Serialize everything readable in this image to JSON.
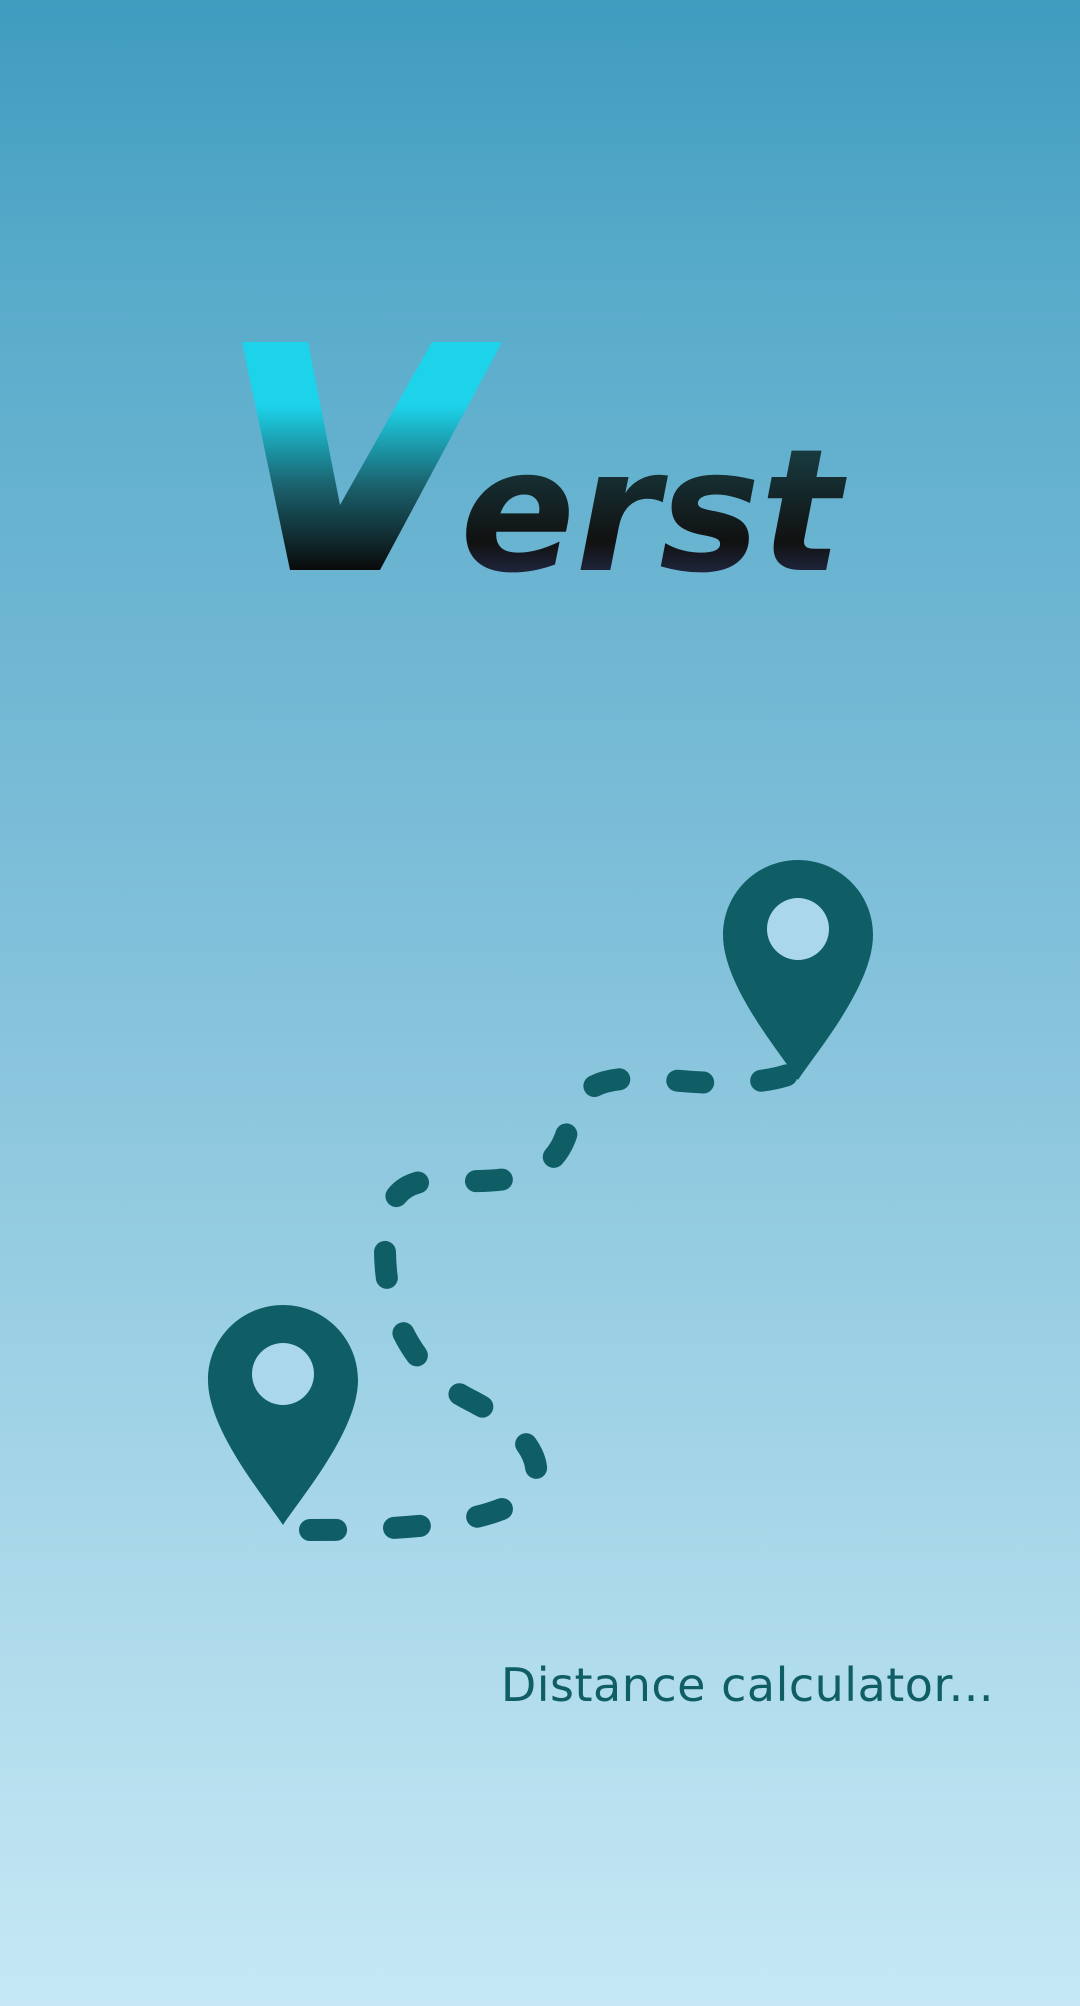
{
  "app": {
    "logo_text": "Verst",
    "tagline": "Distance calculator..."
  },
  "icons": {
    "start_pin": "map-pin-icon",
    "end_pin": "map-pin-icon",
    "route_line": "dashed-route-icon"
  },
  "colors": {
    "background_top": "#3f9cbf",
    "background_bottom": "#c6e8f5",
    "brand_dark": "#0f5e66",
    "logo_cyan": "#1cd3ea",
    "logo_black": "#111111",
    "logo_navy": "#2e3f73"
  }
}
